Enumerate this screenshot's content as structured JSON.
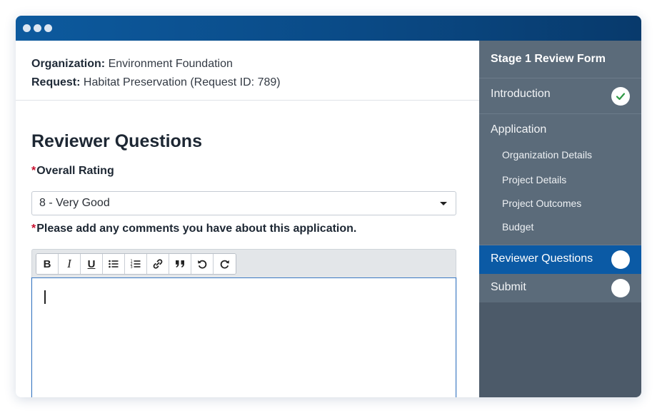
{
  "header": {
    "organization_label": "Organization:",
    "organization_value": "Environment Foundation",
    "request_label": "Request:",
    "request_value": "Habitat Preservation (Request ID: 789)"
  },
  "form": {
    "section_title": "Reviewer Questions",
    "required_marker": "*",
    "rating_label": "Overall Rating",
    "rating_value": "8 - Very Good",
    "comments_label": "Please add any comments you have about this application."
  },
  "toolbar": {
    "bold": "B",
    "italic": "I",
    "underline": "U",
    "icons": [
      "bold-icon",
      "italic-icon",
      "underline-icon",
      "bullet-list-icon",
      "numbered-list-icon",
      "link-icon",
      "quote-icon",
      "undo-icon",
      "redo-icon"
    ]
  },
  "sidebar": {
    "title": "Stage 1 Review Form",
    "items": {
      "introduction": "Introduction",
      "application": "Application",
      "reviewer_questions": "Reviewer Questions",
      "submit": "Submit"
    },
    "sub_items": [
      "Organization Details",
      "Project Details",
      "Project Outcomes",
      "Budget"
    ],
    "status": {
      "introduction": "complete",
      "reviewer_questions": "incomplete",
      "submit": "incomplete"
    }
  },
  "colors": {
    "titlebar": "#0a4a86",
    "sidebar": "#5b6b7a",
    "sidebar_active": "#0b5aa5",
    "required": "#c8102e",
    "check": "#2e9a44"
  }
}
